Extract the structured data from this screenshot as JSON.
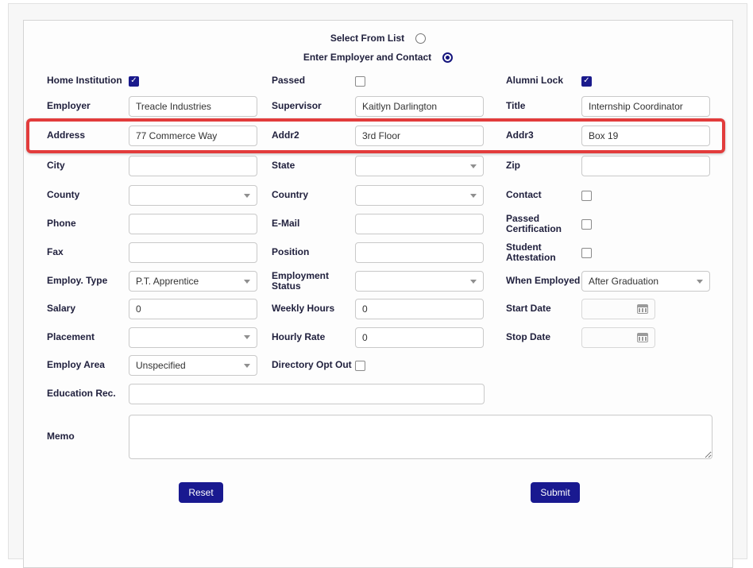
{
  "colors": {
    "accent_navy": "#191990",
    "checkbox_navy": "#1a1a8c",
    "highlight_red": "#e23c3c",
    "label_text": "#21213e"
  },
  "mode_options": [
    {
      "id": "select-from-list",
      "label": "Select From List",
      "selected": false
    },
    {
      "id": "enter-employer-and-contact",
      "label": "Enter Employer and Contact",
      "selected": true
    }
  ],
  "rows": [
    {
      "size": "cb-row",
      "cells": [
        {
          "label": "Home Institution",
          "name": "home-institution",
          "type": "checkbox",
          "checked": true
        },
        {
          "label": "Passed",
          "name": "passed",
          "type": "checkbox",
          "checked": false
        },
        {
          "label": "Alumni Lock",
          "name": "alumni-lock",
          "type": "checkbox",
          "checked": true
        }
      ]
    },
    {
      "cells": [
        {
          "label": "Employer",
          "name": "employer",
          "type": "text",
          "value": "Treacle Industries"
        },
        {
          "label": "Supervisor",
          "name": "supervisor",
          "type": "text",
          "value": "Kaitlyn Darlington"
        },
        {
          "label": "Title",
          "name": "title",
          "type": "text",
          "value": "Internship Coordinator"
        }
      ]
    },
    {
      "size": "addr",
      "highlight": true,
      "cells": [
        {
          "label": "Address",
          "name": "address",
          "type": "text",
          "value": "77 Commerce Way"
        },
        {
          "label": "Addr2",
          "name": "addr2",
          "type": "text",
          "value": "3rd Floor"
        },
        {
          "label": "Addr3",
          "name": "addr3",
          "type": "text",
          "value": "Box 19"
        }
      ]
    },
    {
      "size": "city",
      "cells": [
        {
          "label": "City",
          "name": "city",
          "type": "text",
          "value": ""
        },
        {
          "label": "State",
          "name": "state",
          "type": "select",
          "value": ""
        },
        {
          "label": "Zip",
          "name": "zip",
          "type": "text",
          "value": ""
        }
      ]
    },
    {
      "cells": [
        {
          "label": "County",
          "name": "county",
          "type": "select",
          "value": ""
        },
        {
          "label": "Country",
          "name": "country",
          "type": "select",
          "value": ""
        },
        {
          "label": "Contact",
          "name": "contact",
          "type": "checkbox",
          "checked": false
        }
      ]
    },
    {
      "cells": [
        {
          "label": "Phone",
          "name": "phone",
          "type": "text",
          "value": ""
        },
        {
          "label": "E-Mail",
          "name": "email",
          "type": "text",
          "value": ""
        },
        {
          "label": "Passed Certification",
          "name": "passed-certification",
          "type": "checkbox",
          "checked": false
        }
      ]
    },
    {
      "cells": [
        {
          "label": "Fax",
          "name": "fax",
          "type": "text",
          "value": ""
        },
        {
          "label": "Position",
          "name": "position",
          "type": "text",
          "value": ""
        },
        {
          "label": "Student Attestation",
          "name": "student-attestation",
          "type": "checkbox",
          "checked": false
        }
      ]
    },
    {
      "cells": [
        {
          "label": "Employ. Type",
          "name": "employ-type",
          "type": "select",
          "value": "P.T. Apprentice"
        },
        {
          "label": "Employment Status",
          "name": "employment-status",
          "type": "select",
          "value": ""
        },
        {
          "label": "When Employed",
          "name": "when-employed",
          "type": "select",
          "value": "After Graduation"
        }
      ]
    },
    {
      "size": "short",
      "cells": [
        {
          "label": "Salary",
          "name": "salary",
          "type": "text",
          "value": "0"
        },
        {
          "label": "Weekly Hours",
          "name": "weekly-hours",
          "type": "text",
          "value": "0"
        },
        {
          "label": "Start Date",
          "name": "start-date",
          "type": "date",
          "value": ""
        }
      ]
    },
    {
      "size": "tall37",
      "cells": [
        {
          "label": "Placement",
          "name": "placement",
          "type": "select",
          "value": ""
        },
        {
          "label": "Hourly Rate",
          "name": "hourly-rate",
          "type": "text",
          "value": "0"
        },
        {
          "label": "Stop Date",
          "name": "stop-date",
          "type": "date",
          "value": ""
        }
      ]
    },
    {
      "size": "short",
      "cells": [
        {
          "label": "Employ Area",
          "name": "employ-area",
          "type": "select",
          "value": "Unspecified"
        },
        {
          "label": "Directory Opt Out",
          "name": "directory-opt-out",
          "type": "checkbox",
          "checked": false
        },
        {
          "label": "",
          "name": "spacer",
          "type": "empty"
        }
      ]
    },
    {
      "size": "edu",
      "cells": [
        {
          "label": "Education Rec.",
          "name": "education-rec",
          "type": "text-wide",
          "value": ""
        }
      ]
    },
    {
      "size": "memo-row",
      "cells": [
        {
          "label": "Memo",
          "name": "memo",
          "type": "textarea",
          "value": ""
        }
      ]
    }
  ],
  "buttons": {
    "reset": "Reset",
    "submit": "Submit"
  }
}
